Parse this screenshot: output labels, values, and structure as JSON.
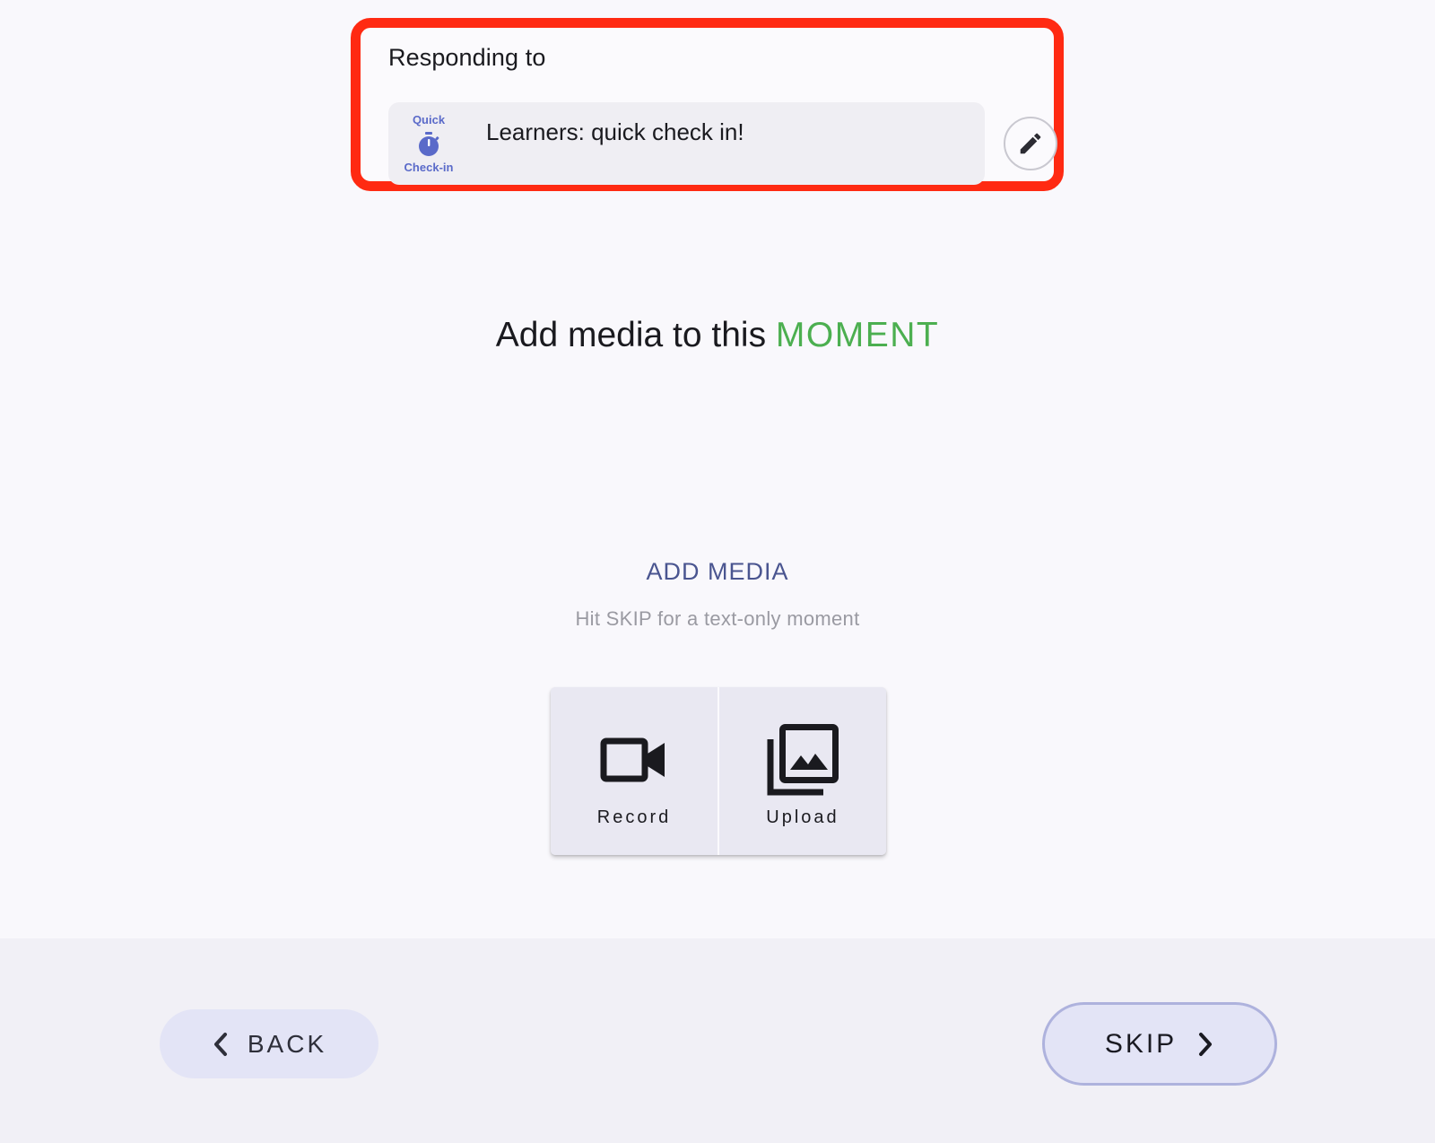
{
  "responding": {
    "label": "Responding to",
    "badge_top": "Quick",
    "badge_bottom": "Check-in",
    "prompt_text": "Learners: quick check in!"
  },
  "title": {
    "prefix": "Add media to this ",
    "accent": "MOMENT"
  },
  "media": {
    "heading": "ADD MEDIA",
    "hint": "Hit SKIP for a text-only moment",
    "options": [
      {
        "label": "Record",
        "icon": "video-camera-icon"
      },
      {
        "label": "Upload",
        "icon": "photo-library-icon"
      }
    ]
  },
  "footer": {
    "back_label": "BACK",
    "skip_label": "SKIP"
  },
  "colors": {
    "highlight_border": "#ff2a12",
    "accent_green": "#4caf50",
    "heading_blue": "#4a5590",
    "badge_blue": "#5a6ac9",
    "button_bg": "#e3e4f6"
  }
}
